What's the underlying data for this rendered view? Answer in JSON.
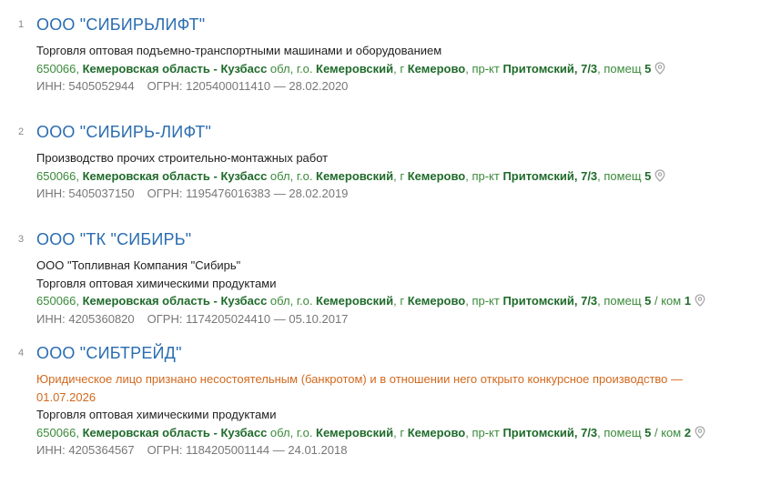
{
  "results": [
    {
      "num": "1",
      "title": "ООО \"СИБИРЬЛИФТ\"",
      "subtitle": "",
      "warning": "",
      "activity": "Торговля оптовая подъемно-транспортными машинами и оборудованием",
      "address": {
        "zip": "650066,",
        "region": "Кемеровская область - Кузбасс",
        "region_type": " обл, г.о. ",
        "district": "Кемеровский",
        "city_prefix": ", г ",
        "city": "Кемерово",
        "street_prefix": ", пр-кт ",
        "street": "Притомский, 7/3",
        "room_prefix": ", помещ ",
        "room": "5",
        "extra_prefix": "",
        "extra": ""
      },
      "inn": "ИНН: 5405052944",
      "ogrn": "ОГРН: 1205400011410 — 28.02.2020"
    },
    {
      "num": "2",
      "title": "ООО \"СИБИРЬ-ЛИФТ\"",
      "subtitle": "",
      "warning": "",
      "activity": "Производство прочих строительно-монтажных работ",
      "address": {
        "zip": "650066,",
        "region": "Кемеровская область - Кузбасс",
        "region_type": " обл, г.о. ",
        "district": "Кемеровский",
        "city_prefix": ", г ",
        "city": "Кемерово",
        "street_prefix": ", пр-кт ",
        "street": "Притомский, 7/3",
        "room_prefix": ", помещ ",
        "room": "5",
        "extra_prefix": "",
        "extra": ""
      },
      "inn": "ИНН: 5405037150",
      "ogrn": "ОГРН: 1195476016383 — 28.02.2019"
    },
    {
      "num": "3",
      "title": "ООО \"ТК \"СИБИРЬ\"",
      "subtitle": "ООО \"Топливная Компания \"Сибирь\"",
      "warning": "",
      "activity": "Торговля оптовая химическими продуктами",
      "address": {
        "zip": "650066,",
        "region": "Кемеровская область - Кузбасс",
        "region_type": " обл, г.о. ",
        "district": "Кемеровский",
        "city_prefix": ", г ",
        "city": "Кемерово",
        "street_prefix": ", пр-кт ",
        "street": "Притомский, 7/3",
        "room_prefix": ", помещ ",
        "room": "5",
        "extra_prefix": " / ком ",
        "extra": "1"
      },
      "inn": "ИНН: 4205360820",
      "ogrn": "ОГРН: 1174205024410 — 05.10.2017"
    },
    {
      "num": "4",
      "title": "ООО \"СИБТРЕЙД\"",
      "subtitle": "",
      "warning": "Юридическое лицо признано несостоятельным (банкротом) и в отношении него открыто конкурсное производство — 01.07.2026",
      "activity": "Торговля оптовая химическими продуктами",
      "address": {
        "zip": "650066,",
        "region": "Кемеровская область - Кузбасс",
        "region_type": " обл, г.о. ",
        "district": "Кемеровский",
        "city_prefix": ", г ",
        "city": "Кемерово",
        "street_prefix": ", пр-кт ",
        "street": "Притомский, 7/3",
        "room_prefix": ", помещ ",
        "room": "5",
        "extra_prefix": " / ком ",
        "extra": "2"
      },
      "inn": "ИНН: 4205364567",
      "ogrn": "ОГРН: 1184205001144 — 24.01.2018"
    }
  ],
  "icons": {
    "map_pin": "map-pin-icon"
  },
  "colors": {
    "title": "#2a6db0",
    "address": "#3a8a3a",
    "address_bold": "#1f6b2a",
    "warning": "#d2691e",
    "meta": "#777777"
  }
}
